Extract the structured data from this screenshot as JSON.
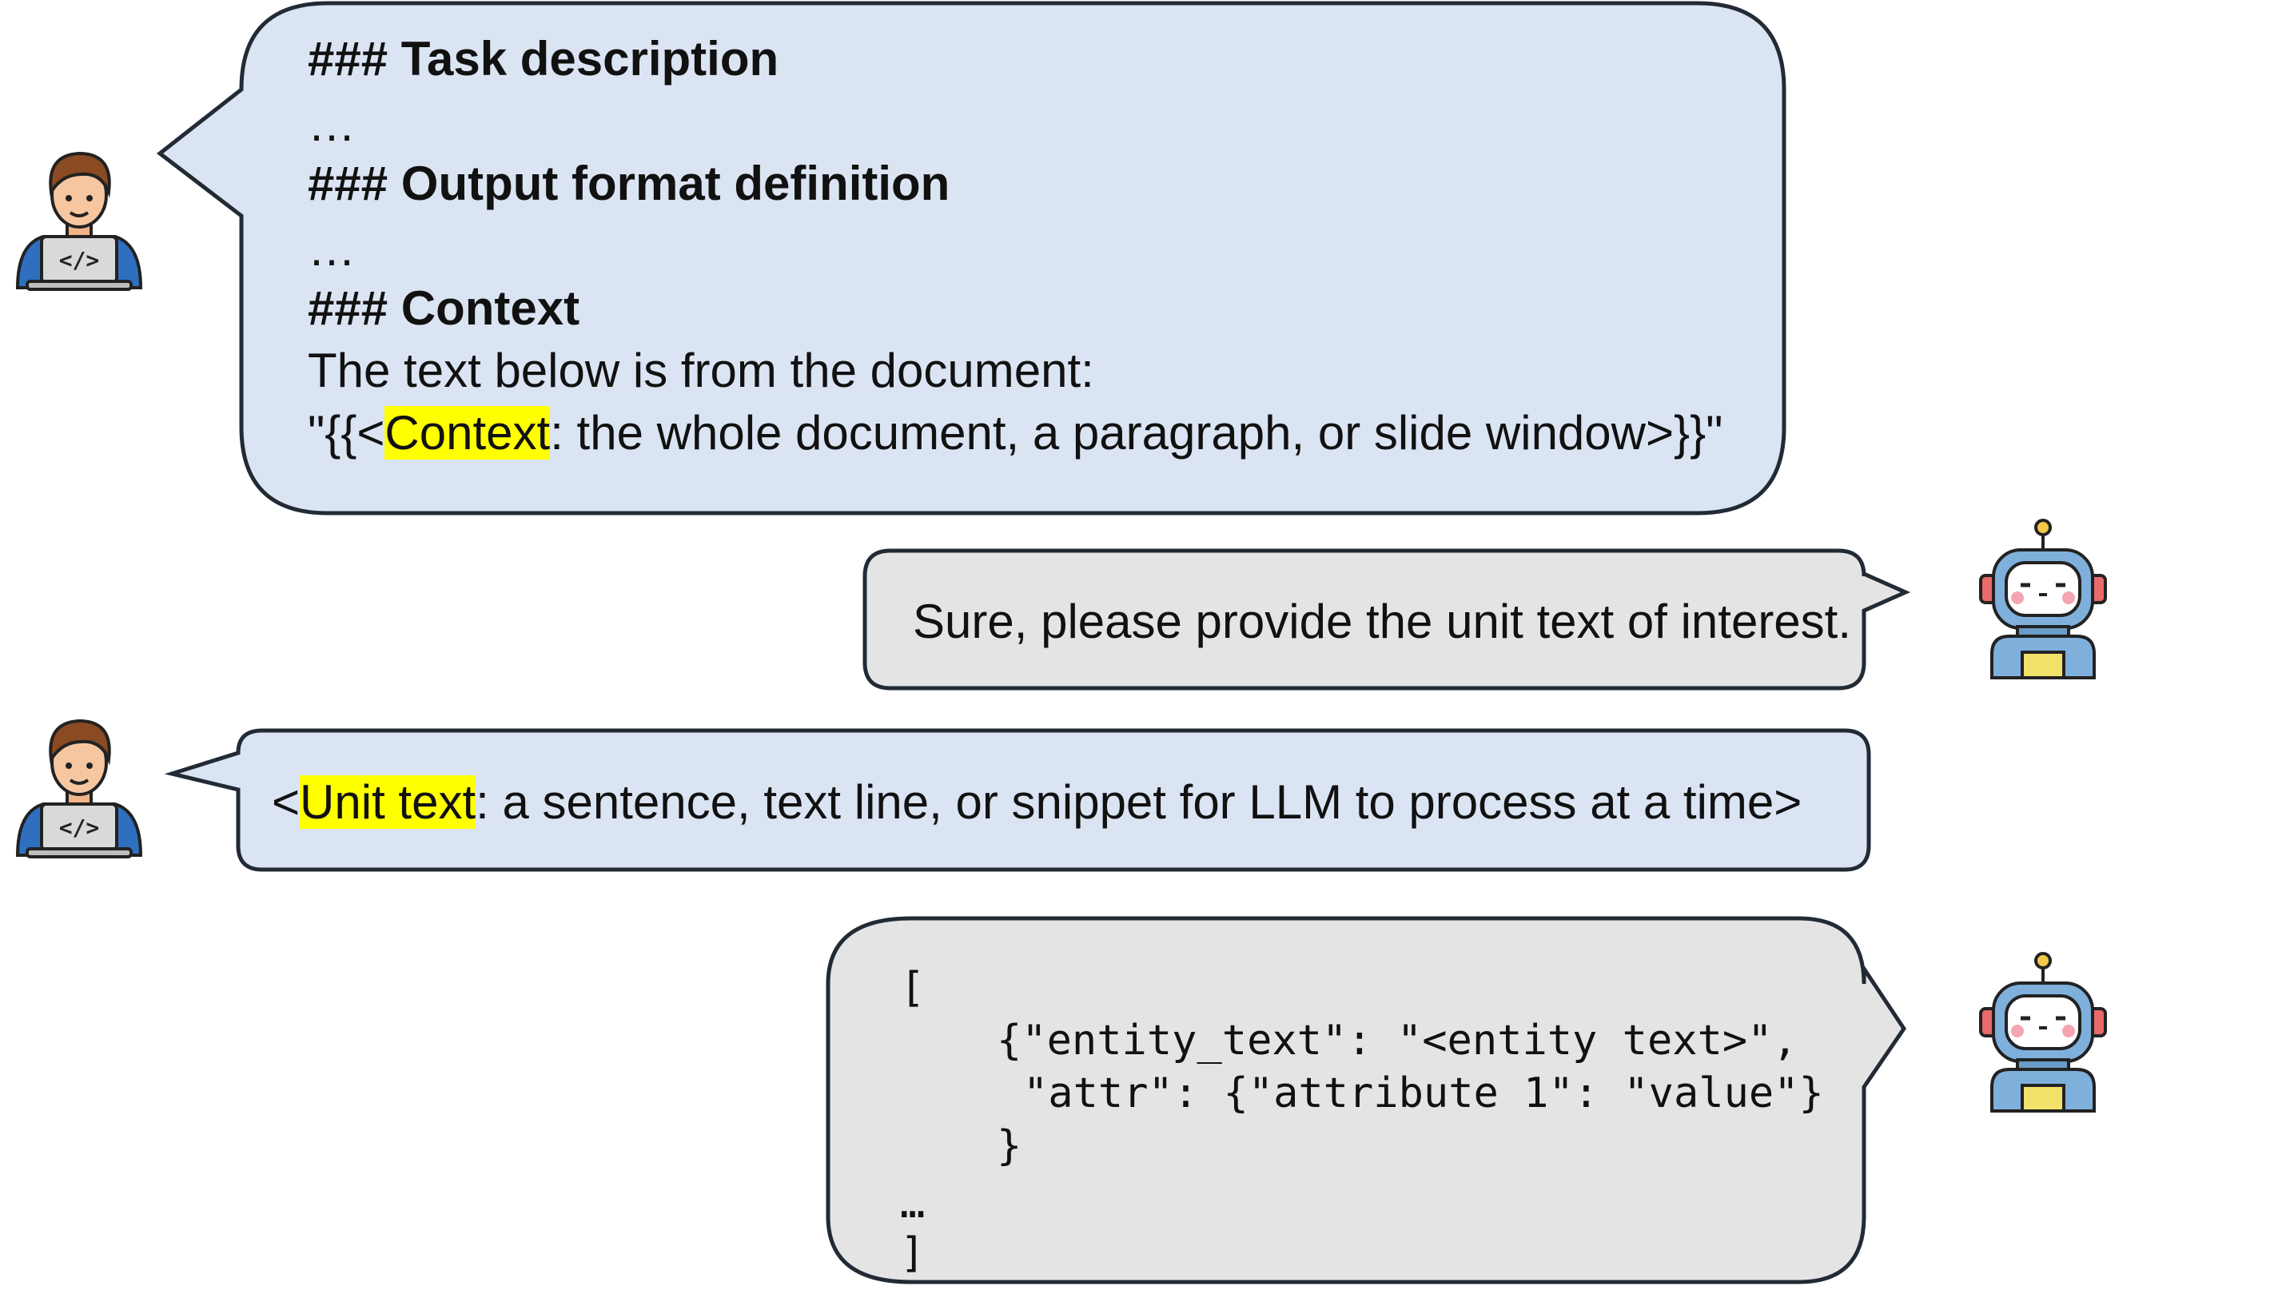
{
  "colors": {
    "user_bubble": "#dbe4f3",
    "bot_bubble": "#e4e4e4",
    "outline": "#222a35",
    "highlight": "#ffff00"
  },
  "icons": {
    "user": "user-programmer-icon",
    "bot": "robot-icon"
  },
  "messages": {
    "prompt": {
      "task_heading": "### Task description",
      "ellipsis_1": "…",
      "format_heading": "### Output format definition",
      "ellipsis_2": "…",
      "context_heading": "### Context",
      "context_intro": "The text below is from the document:",
      "context_pre": "\"{{<",
      "context_highlight": "Context",
      "context_post": ": the whole document, a paragraph, or slide window>}}\""
    },
    "bot_reply": {
      "text": "Sure, please provide the unit text of interest."
    },
    "unit_text": {
      "pre": "<",
      "highlight": "Unit text",
      "post": ": a sentence, text line, or snippet for LLM to process at a time>"
    },
    "bot_output": {
      "line_1": "[",
      "line_2": "{\"entity_text\": \"<entity text>\",",
      "line_3": "\"attr\": {\"attribute 1\": \"value\"}",
      "line_4": "}",
      "line_5": "…",
      "line_6": "]"
    }
  }
}
